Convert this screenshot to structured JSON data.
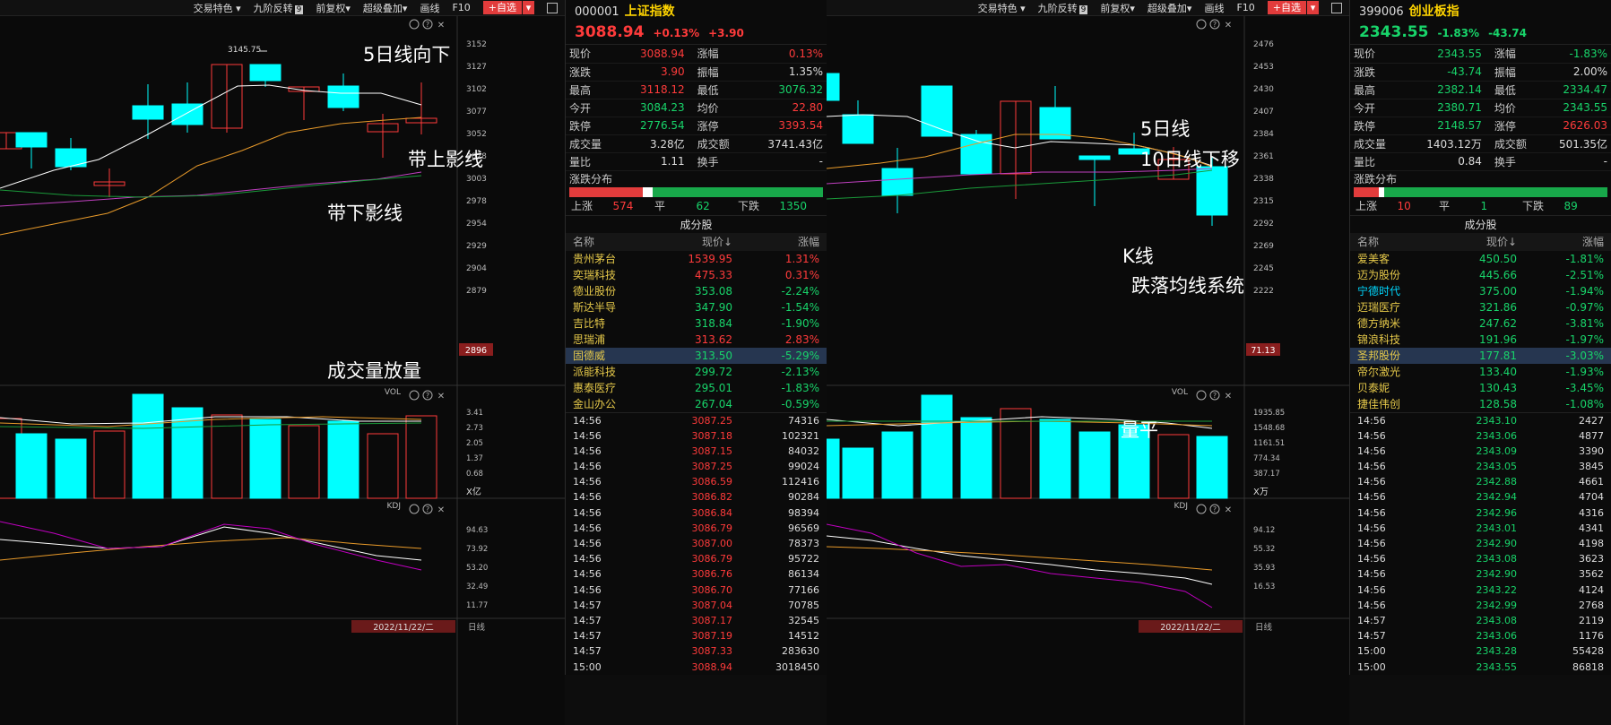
{
  "toolbar": {
    "items": [
      "交易特色",
      "九阶反转",
      "前复权",
      "超级叠加",
      "画线",
      "F10"
    ],
    "badge": "9",
    "add_label": "+自选",
    "dropdown": "▾"
  },
  "left": {
    "code": "000001",
    "name": "上证指数",
    "price": "3088.94",
    "chg_pct": "+0.13%",
    "chg": "+3.90",
    "quote": [
      [
        "现价",
        "3088.94",
        "red",
        "涨幅",
        "0.13%",
        "red"
      ],
      [
        "涨跌",
        "3.90",
        "red",
        "振幅",
        "1.35%",
        "wht"
      ],
      [
        "最高",
        "3118.12",
        "red",
        "最低",
        "3076.32",
        "grn"
      ],
      [
        "今开",
        "3084.23",
        "grn",
        "均价",
        "22.80",
        "red"
      ],
      [
        "跌停",
        "2776.54",
        "grn",
        "涨停",
        "3393.54",
        "red"
      ],
      [
        "成交量",
        "3.28亿",
        "wht",
        "成交额",
        "3741.43亿",
        "wht"
      ],
      [
        "量比",
        "1.11",
        "wht",
        "换手",
        "-",
        "wht"
      ]
    ],
    "dist_label": "涨跌分布",
    "dist_up_frac": 0.29,
    "dist_flat_frac": 0.03,
    "counts": {
      "up_label": "上涨",
      "up": "574",
      "flat_label": "平",
      "flat": "62",
      "down_label": "下跌",
      "down": "1350"
    },
    "components_title": "成分股",
    "headers": [
      "名称",
      "现价↓",
      "涨幅"
    ],
    "stocks": [
      [
        "贵州茅台",
        "1539.95",
        "1.31%",
        "red"
      ],
      [
        "奕瑞科技",
        "475.33",
        "0.31%",
        "red"
      ],
      [
        "德业股份",
        "353.08",
        "-2.24%",
        "grn"
      ],
      [
        "斯达半导",
        "347.90",
        "-1.54%",
        "grn"
      ],
      [
        "吉比特",
        "318.84",
        "-1.90%",
        "grn"
      ],
      [
        "思瑞浦",
        "313.62",
        "2.83%",
        "red"
      ],
      [
        "固德威",
        "313.50",
        "-5.29%",
        "grn"
      ],
      [
        "派能科技",
        "299.72",
        "-2.13%",
        "grn"
      ],
      [
        "惠泰医疗",
        "295.01",
        "-1.83%",
        "grn"
      ],
      [
        "金山办公",
        "267.04",
        "-0.59%",
        "grn"
      ]
    ],
    "ticks": [
      [
        "14:56",
        "3087.25",
        "74316"
      ],
      [
        "14:56",
        "3087.18",
        "102321"
      ],
      [
        "14:56",
        "3087.15",
        "84032"
      ],
      [
        "14:56",
        "3087.25",
        "99024"
      ],
      [
        "14:56",
        "3086.59",
        "112416"
      ],
      [
        "14:56",
        "3086.82",
        "90284"
      ],
      [
        "14:56",
        "3086.84",
        "98394"
      ],
      [
        "14:56",
        "3086.79",
        "96569"
      ],
      [
        "14:56",
        "3087.00",
        "78373"
      ],
      [
        "14:56",
        "3086.79",
        "95722"
      ],
      [
        "14:56",
        "3086.76",
        "86134"
      ],
      [
        "14:56",
        "3086.70",
        "77166"
      ],
      [
        "14:57",
        "3087.04",
        "70785"
      ],
      [
        "14:57",
        "3087.17",
        "32545"
      ],
      [
        "14:57",
        "3087.19",
        "14512"
      ],
      [
        "14:57",
        "3087.33",
        "283630"
      ],
      [
        "15:00",
        "3088.94",
        "3018450"
      ]
    ],
    "price_axis": [
      "3152",
      "3127",
      "3102",
      "3077",
      "3052",
      "3028",
      "3003",
      "2978",
      "2954",
      "2929",
      "2904",
      "2879"
    ],
    "price_tag": "2896",
    "high_label": "3145.75",
    "vol_label": "VOL",
    "vol_axis": [
      "3.41",
      "2.73",
      "2.05",
      "1.37",
      "0.68"
    ],
    "vol_unit": "X亿",
    "kdj_label": "KDJ",
    "kdj_axis": [
      "94.63",
      "73.92",
      "53.20",
      "32.49",
      "11.77"
    ],
    "date": "2022/11/22/二",
    "period": "日线",
    "annotations": [
      "5日线向下",
      "带上影线",
      "带下影线",
      "成交量放量"
    ],
    "icons": [
      "settings-icon",
      "help-icon",
      "close-icon"
    ]
  },
  "right": {
    "code": "399006",
    "name": "创业板指",
    "price": "2343.55",
    "chg_pct": "-1.83%",
    "chg": "-43.74",
    "quote": [
      [
        "现价",
        "2343.55",
        "grn",
        "涨幅",
        "-1.83%",
        "grn"
      ],
      [
        "涨跌",
        "-43.74",
        "grn",
        "振幅",
        "2.00%",
        "wht"
      ],
      [
        "最高",
        "2382.14",
        "grn",
        "最低",
        "2334.47",
        "grn"
      ],
      [
        "今开",
        "2380.71",
        "grn",
        "均价",
        "2343.55",
        "grn"
      ],
      [
        "跌停",
        "2148.57",
        "grn",
        "涨停",
        "2626.03",
        "red"
      ],
      [
        "成交量",
        "1403.12万",
        "wht",
        "成交额",
        "501.35亿",
        "wht"
      ],
      [
        "量比",
        "0.84",
        "wht",
        "换手",
        "-",
        "wht"
      ]
    ],
    "dist_label": "涨跌分布",
    "dist_up_frac": 0.1,
    "dist_flat_frac": 0.01,
    "counts": {
      "up_label": "上涨",
      "up": "10",
      "flat_label": "平",
      "flat": "1",
      "down_label": "下跌",
      "down": "89"
    },
    "components_title": "成分股",
    "headers": [
      "名称",
      "现价↓",
      "涨幅"
    ],
    "stocks": [
      [
        "爱美客",
        "450.50",
        "-1.81%",
        "grn"
      ],
      [
        "迈为股份",
        "445.66",
        "-2.51%",
        "grn"
      ],
      [
        "宁德时代",
        "375.00",
        "-1.94%",
        "grn"
      ],
      [
        "迈瑞医疗",
        "321.86",
        "-0.97%",
        "grn"
      ],
      [
        "德方纳米",
        "247.62",
        "-3.81%",
        "grn"
      ],
      [
        "锦浪科技",
        "191.96",
        "-1.97%",
        "grn"
      ],
      [
        "圣邦股份",
        "177.81",
        "-3.03%",
        "grn"
      ],
      [
        "帝尔激光",
        "133.40",
        "-1.93%",
        "grn"
      ],
      [
        "贝泰妮",
        "130.43",
        "-3.45%",
        "grn"
      ],
      [
        "捷佳伟创",
        "128.58",
        "-1.08%",
        "grn"
      ]
    ],
    "ticks": [
      [
        "14:56",
        "2343.10",
        "2427"
      ],
      [
        "14:56",
        "2343.06",
        "4877"
      ],
      [
        "14:56",
        "2343.09",
        "3390"
      ],
      [
        "14:56",
        "2343.05",
        "3845"
      ],
      [
        "14:56",
        "2342.88",
        "4661"
      ],
      [
        "14:56",
        "2342.94",
        "4704"
      ],
      [
        "14:56",
        "2342.96",
        "4316"
      ],
      [
        "14:56",
        "2343.01",
        "4341"
      ],
      [
        "14:56",
        "2342.90",
        "4198"
      ],
      [
        "14:56",
        "2343.08",
        "3623"
      ],
      [
        "14:56",
        "2342.90",
        "3562"
      ],
      [
        "14:56",
        "2343.22",
        "4124"
      ],
      [
        "14:56",
        "2342.99",
        "2768"
      ],
      [
        "14:57",
        "2343.08",
        "2119"
      ],
      [
        "14:57",
        "2343.06",
        "1176"
      ],
      [
        "15:00",
        "2343.28",
        "55428"
      ],
      [
        "15:00",
        "2343.55",
        "86818"
      ]
    ],
    "price_axis": [
      "2476",
      "2453",
      "2430",
      "2407",
      "2384",
      "2361",
      "2338",
      "2315",
      "2292",
      "2269",
      "2245",
      "2222"
    ],
    "price_tag": "71.13",
    "vol_label": "VOL",
    "vol_axis": [
      "1935.85",
      "1548.68",
      "1161.51",
      "774.34",
      "387.17"
    ],
    "vol_unit": "X万",
    "kdj_label": "KDJ",
    "kdj_axis": [
      "94.12",
      "55.32",
      "35.93",
      "16.53"
    ],
    "date": "2022/11/22/二",
    "period": "日线",
    "annotations": [
      "5日线",
      "10日线下移",
      "K线",
      "跌落均线系统",
      "量平"
    ]
  },
  "colors": {
    "up": "#ff3b3b",
    "down": "#00ffff",
    "ma5": "#ffffff",
    "ma10": "#e89a2a",
    "ma20": "#c040c0",
    "ma30": "#1a9a3a"
  }
}
